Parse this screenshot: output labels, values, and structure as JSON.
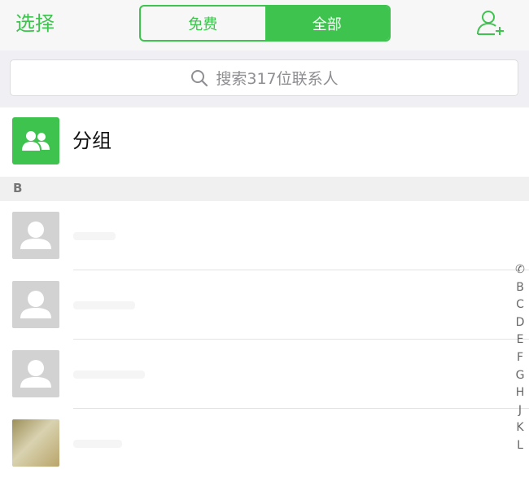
{
  "nav": {
    "select_label": "选择",
    "segment": {
      "free_label": "免费",
      "all_label": "全部",
      "selected": "全部"
    }
  },
  "search": {
    "placeholder": "搜索317位联系人"
  },
  "group": {
    "label": "分组"
  },
  "section": {
    "letter": "B"
  },
  "index_bar": [
    "✆",
    "B",
    "C",
    "D",
    "E",
    "F",
    "G",
    "H",
    "J",
    "K",
    "L"
  ],
  "colors": {
    "accent": "#3fc34f",
    "nav_bg": "#f7f7f7",
    "search_bg": "#efeff4",
    "avatar_placeholder": "#d2d2d2"
  }
}
